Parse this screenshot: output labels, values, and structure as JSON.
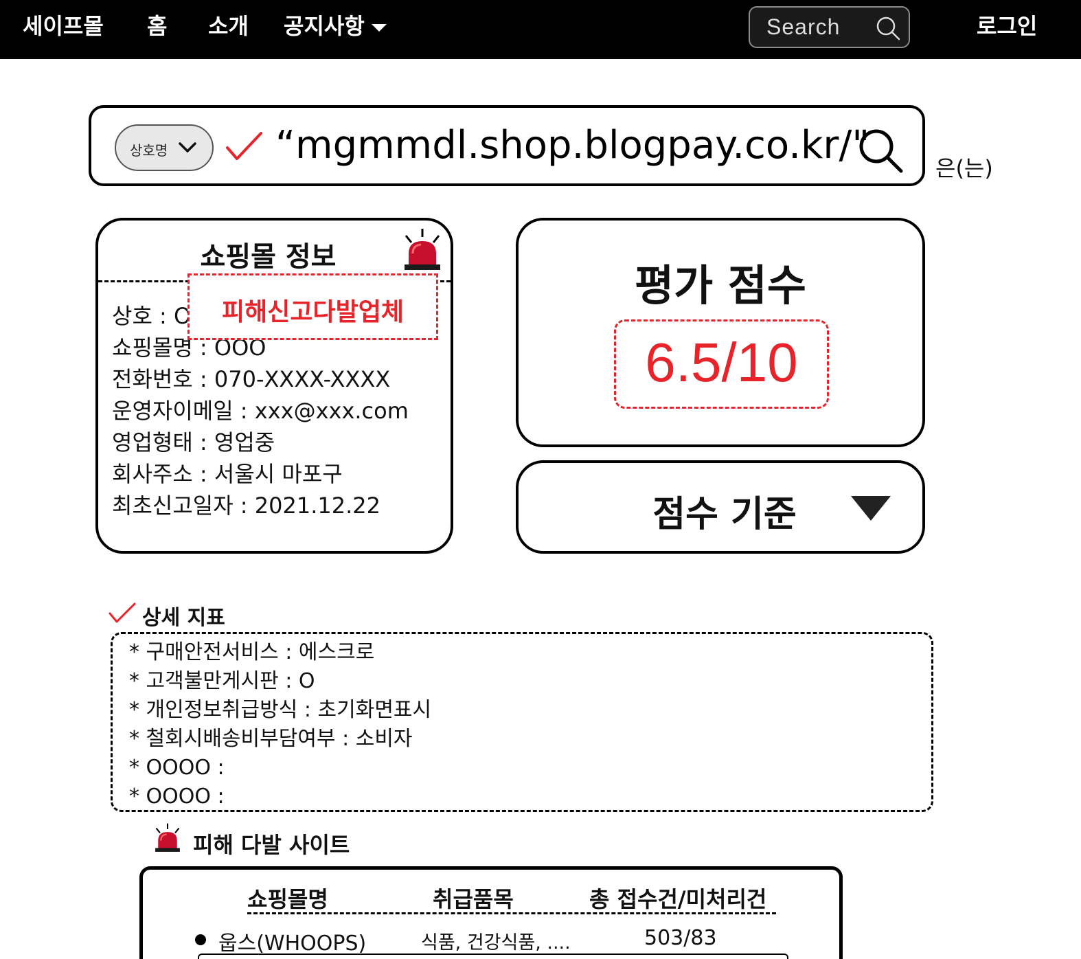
{
  "nav": {
    "brand": "세이프몰",
    "items": [
      "홈",
      "소개"
    ],
    "notice_label": "공지사항",
    "search_placeholder": "Search",
    "login_label": "로그인"
  },
  "search": {
    "type_label": "상호명",
    "query": "“mgmmdl.shop.blogpay.co.kr/\"",
    "suffix": "은(는)"
  },
  "shop_info": {
    "title": "쇼핑몰 정보",
    "warning_badge": "피해신고다발업체",
    "rows": [
      "상호 : OOO",
      "쇼핑몰명 : OOO",
      "전화번호 : 070-XXXX-XXXX",
      "운영자이메일 : xxx@xxx.com",
      "영업형태 : 영업중",
      "회사주소 : 서울시 마포구",
      "최초신고일자 : 2021.12.22"
    ]
  },
  "score": {
    "title": "평가 점수",
    "value": "6.5/10",
    "criteria_label": "점수 기준"
  },
  "details": {
    "title": "상세 지표",
    "items": [
      "* 구매안전서비스 : 에스크로",
      "* 고객불만게시판 : O",
      "* 개인정보취급방식 : 초기화면표시",
      "* 철회시배송비부담여부 : 소비자",
      "* OOOO :",
      "* OOOO :"
    ]
  },
  "damage_sites": {
    "title": "피해 다발 사이트",
    "headers": [
      "쇼핑몰명",
      "취급품목",
      "총 접수건/미처리건"
    ],
    "rows": [
      {
        "name": "웁스(WHOOPS)",
        "items": "식품, 건강식품, ....",
        "counts": "503/83"
      }
    ]
  },
  "colors": {
    "accent_red": "#e8232a",
    "nav_bg": "#000000",
    "siren_red": "#c8102e"
  }
}
